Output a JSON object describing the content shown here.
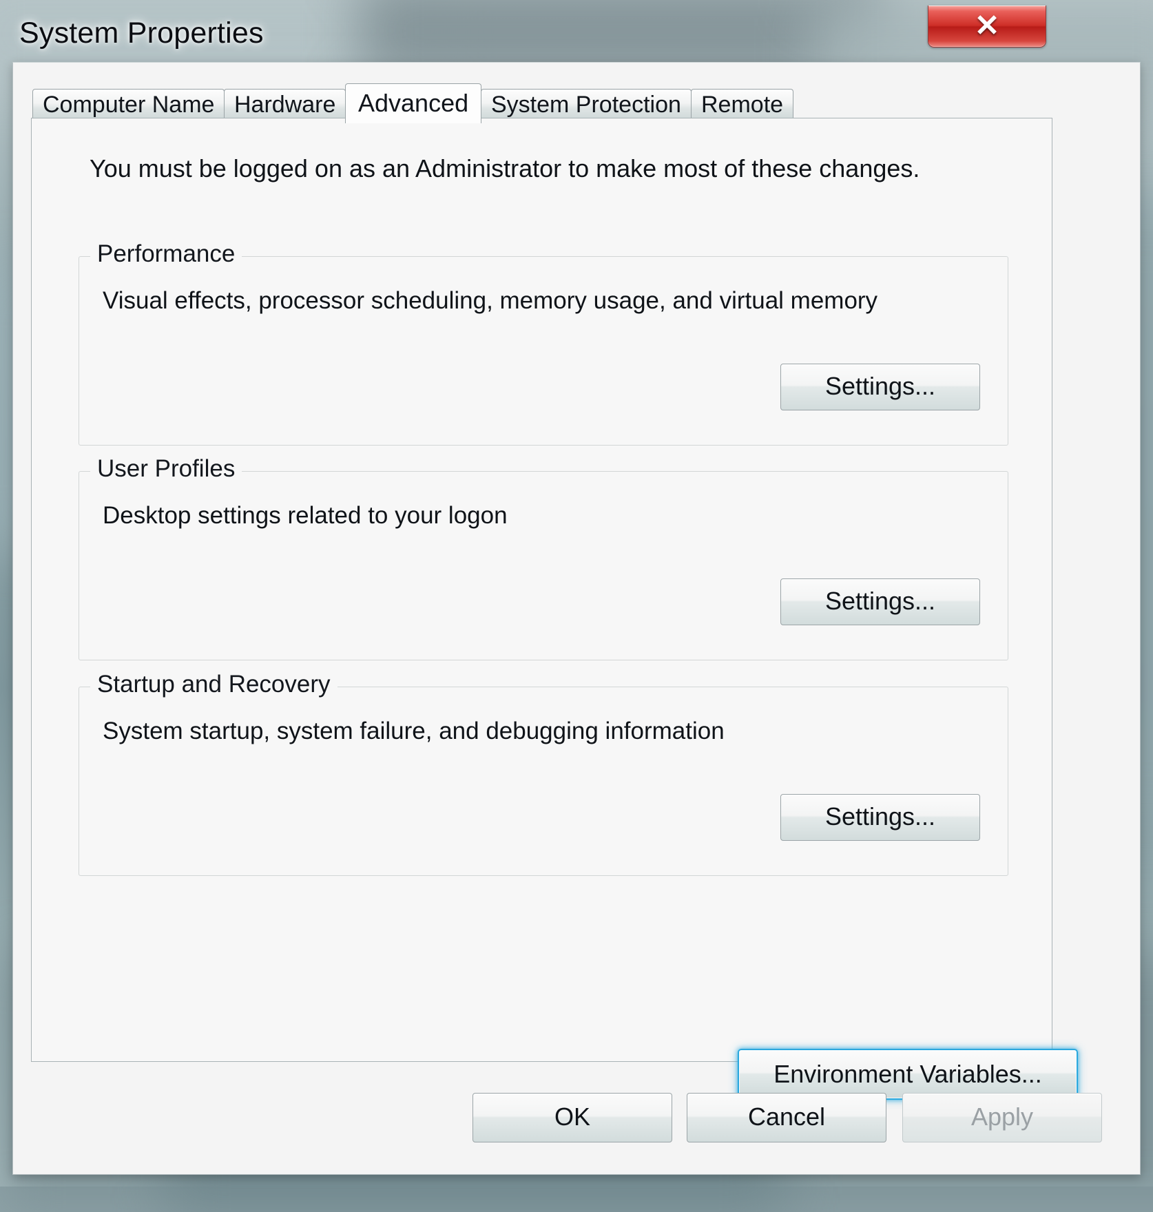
{
  "window": {
    "title": "System Properties",
    "close_glyph": "✕",
    "close_label": "Close"
  },
  "tabs": [
    {
      "label": "Computer Name",
      "active": false
    },
    {
      "label": "Hardware",
      "active": false
    },
    {
      "label": "Advanced",
      "active": true
    },
    {
      "label": "System Protection",
      "active": false
    },
    {
      "label": "Remote",
      "active": false
    }
  ],
  "page": {
    "admin_note": "You must be logged on as an Administrator to make most of these changes.",
    "groups": [
      {
        "legend": "Performance",
        "description": "Visual effects, processor scheduling, memory usage, and virtual memory",
        "button_label": "Settings..."
      },
      {
        "legend": "User Profiles",
        "description": "Desktop settings related to your logon",
        "button_label": "Settings..."
      },
      {
        "legend": "Startup and Recovery",
        "description": "System startup, system failure, and debugging information",
        "button_label": "Settings..."
      }
    ],
    "environment_variables_label": "Environment Variables..."
  },
  "footer": {
    "ok_label": "OK",
    "cancel_label": "Cancel",
    "apply_label": "Apply"
  },
  "colors": {
    "focus_glow": "#2aa8de",
    "close_red": "#cf2f28",
    "dialog_face": "#f4f4f4",
    "tab_page": "#f7f7f7",
    "text": "#0f1318",
    "disabled_text": "#9aa0a4"
  }
}
